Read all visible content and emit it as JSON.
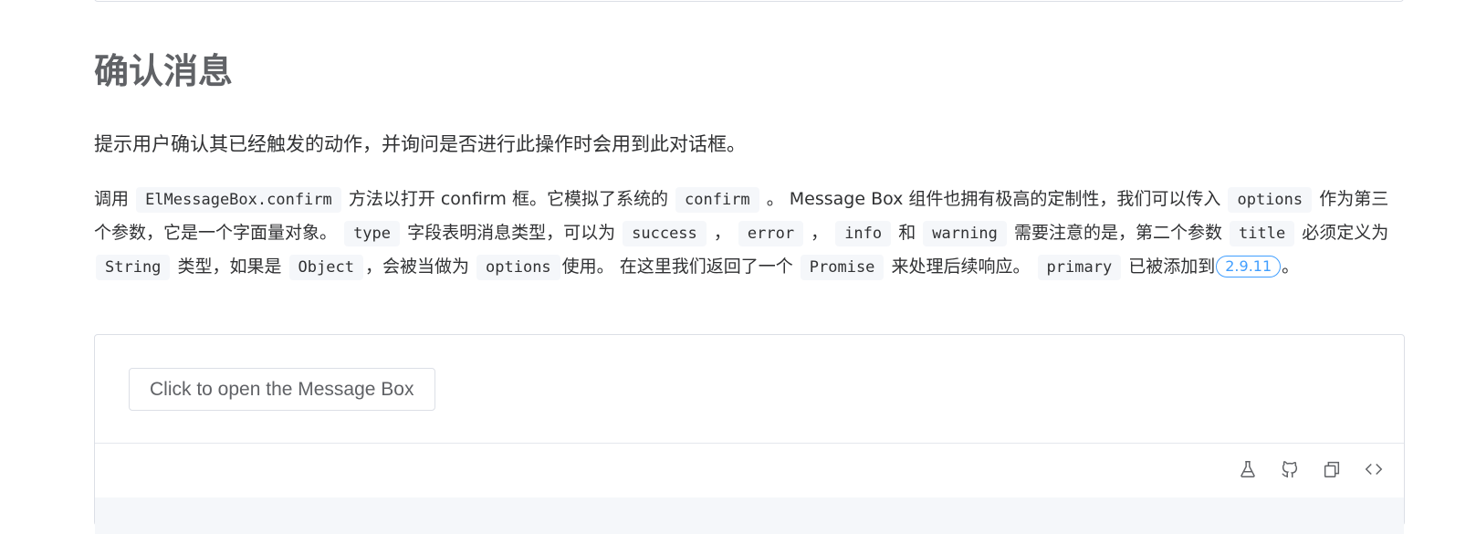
{
  "section": {
    "title": "确认消息",
    "lead": "提示用户确认其已经触发的动作，并询问是否进行此操作时会用到此对话框。",
    "body": {
      "t1": "调用",
      "c1": "ElMessageBox.confirm",
      "t2": "方法以打开 confirm 框。它模拟了系统的",
      "c2": "confirm",
      "t3": "。 Message Box 组件也拥有极高的定制性，我们可以传入",
      "c3": "options",
      "t4": "作为第三个参数，它是一个字面量对象。",
      "c4": "type",
      "t5": "字段表明消息类型，可以为",
      "c5": "success",
      "t6": "，",
      "c6": "error",
      "t7": "，",
      "c7": "info",
      "t8": "和",
      "c8": "warning",
      "t9": "需要注意的是，第二个参数",
      "c9": "title",
      "t10": "必须定义为",
      "c10": "String",
      "t11": "类型，如果是",
      "c11": "Object",
      "t12": "，会被当做为",
      "c12": "options",
      "t13": "使用。 在这里我们返回了一个",
      "c13": "Promise",
      "t14": "来处理后续响应。",
      "c14": "primary",
      "t15": "已被添加到",
      "version": "2.9.11",
      "t16": "。"
    }
  },
  "demo": {
    "button_label": "Click to open the Message Box",
    "actions": [
      {
        "icon": "flask-icon",
        "name": "playground"
      },
      {
        "icon": "github-icon",
        "name": "github"
      },
      {
        "icon": "copy-icon",
        "name": "copy"
      },
      {
        "icon": "code-icon",
        "name": "view-source"
      }
    ]
  },
  "colors": {
    "accent": "#409eff",
    "text": "#303133",
    "heading": "#606266",
    "border": "#dcdfe6",
    "code_bg": "#f5f7fa"
  }
}
